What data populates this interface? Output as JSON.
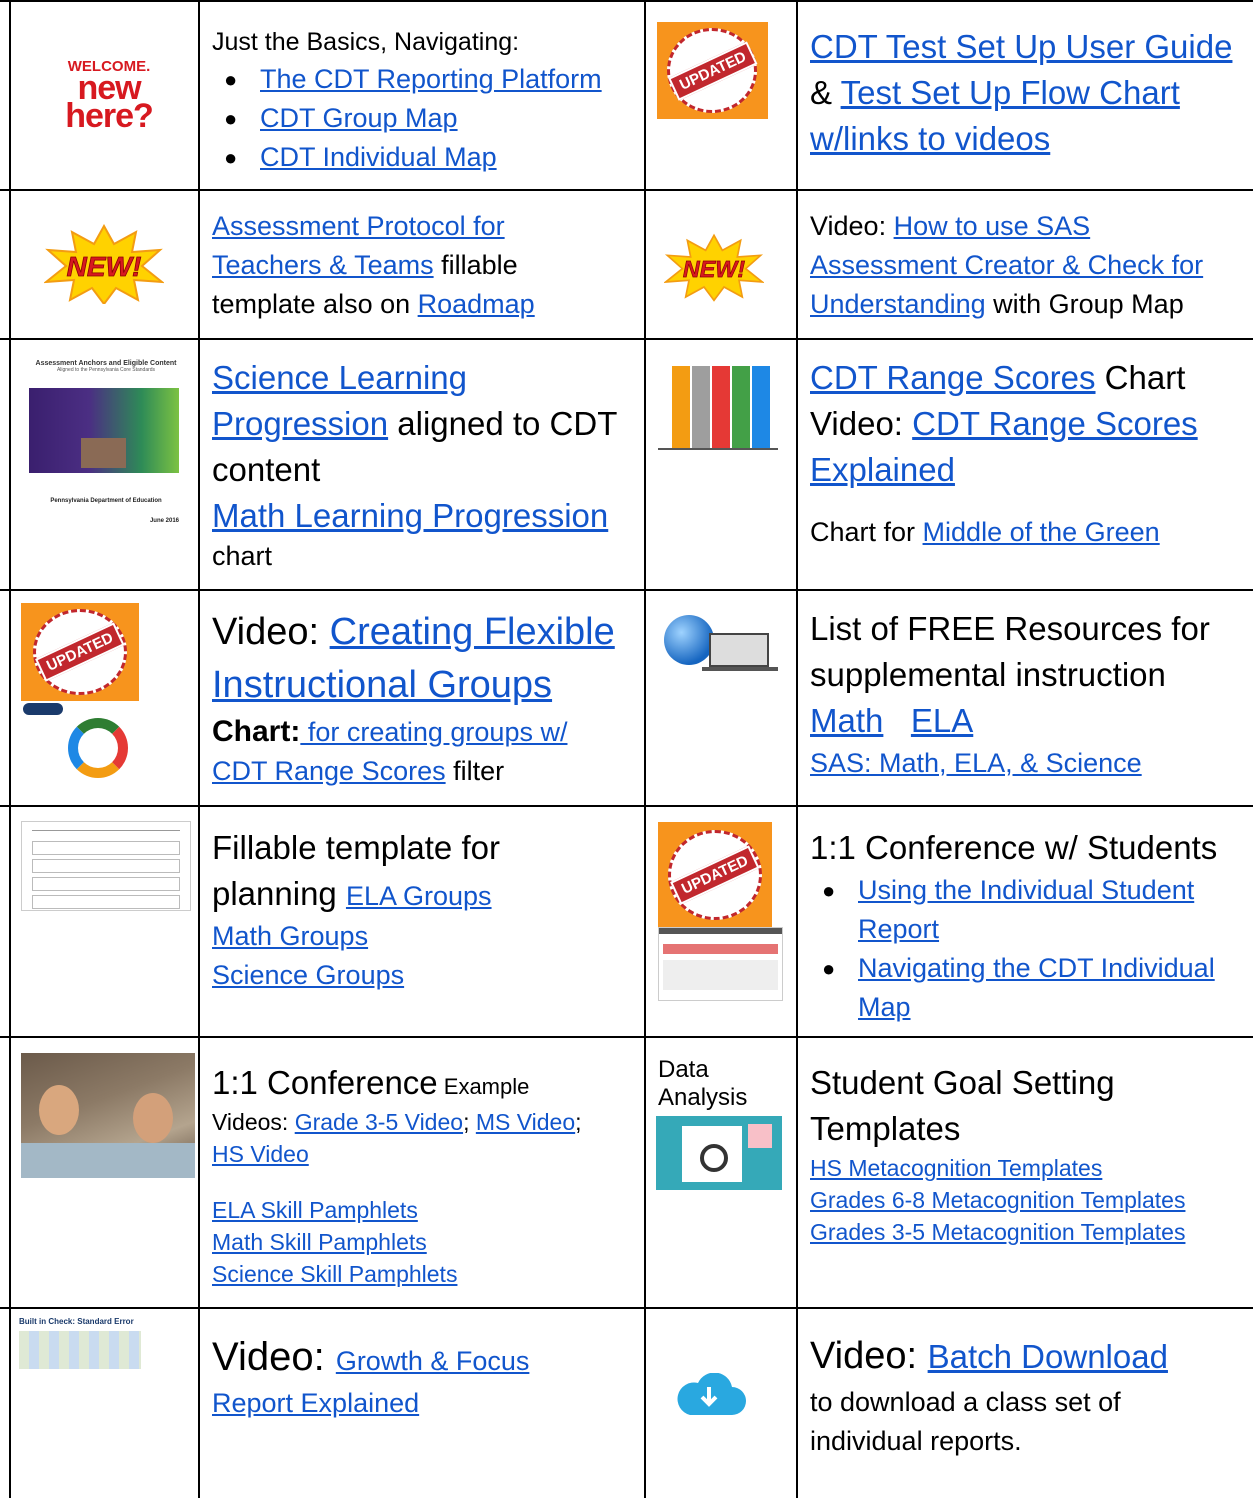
{
  "rows": {
    "r1": {
      "welcome_image": {
        "line1": "WELCOME.",
        "line2": "new",
        "line3": "here?"
      },
      "basics_heading": "Just the Basics, Navigating:",
      "basics_links": [
        "The CDT Reporting Platform",
        "CDT Group Map",
        "CDT Individual Map"
      ],
      "updated_stamp": "UPDATED",
      "guide_link": "CDT Test Set Up User Guide",
      "amp": "&",
      "flow_link_1": "Test Set Up Flow Chart",
      "flow_link_2": "w/links to videos"
    },
    "r2": {
      "new_badge": "NEW!",
      "protocol_link_1": "Assessment Protocol for",
      "protocol_link_2": "Teachers & Teams",
      "protocol_text_1": " fillable",
      "protocol_text_2": "template also on ",
      "roadmap_link": "Roadmap",
      "video_label": "Video: ",
      "sas_link_1": "How to use SAS",
      "sas_link_2": "Assessment Creator & Check for",
      "sas_link_3": "Understanding",
      "sas_text": " with Group Map"
    },
    "r3": {
      "doc_title": "Assessment Anchors and Eligible Content",
      "doc_subtitle": "Aligned to the Pennsylvania Core Standards",
      "doc_footer": "Pennsylvania Department of Education",
      "doc_date": "June 2016",
      "science_link_1": "Science Learning",
      "science_link_2": "Progression",
      "science_text": " aligned to CDT",
      "science_text_2": "content",
      "math_link": "Math Learning Progression",
      "math_text": "chart",
      "range_link": "CDT Range Scores",
      "range_text": " Chart",
      "video_label": "Video: ",
      "explained_link_1": "CDT Range Scores",
      "explained_link_2": "Explained",
      "green_text": "Chart for ",
      "green_link": "Middle of the Green"
    },
    "r4": {
      "updated_stamp": "UPDATED",
      "video_label": "Video: ",
      "flex_link_1": "Creating Flexible",
      "flex_link_2": "Instructional Groups",
      "chart_bold": "Chart:",
      "chart_link_1": " for creating groups w/",
      "chart_link_2": "CDT Range Scores",
      "chart_text": " filter",
      "free_text_1": "List of FREE Resources for",
      "free_text_2": "supplemental instruction",
      "math_link": "Math",
      "ela_link": "ELA",
      "sas_link": "SAS: Math, ELA, & Science"
    },
    "r5": {
      "fill_text_1": "Fillable template for",
      "fill_text_2": "planning ",
      "ela_groups": "ELA Groups",
      "math_groups": "Math Groups",
      "science_groups": "Science Groups",
      "updated_stamp": "UPDATED",
      "conf_title": "1:1 Conference w/ Students",
      "conf_link_1a": "Using the Individual Student",
      "conf_link_1b": "Report",
      "conf_link_2a": "Navigating the CDT Individual",
      "conf_link_2b": "Map"
    },
    "r6": {
      "conf_title": "1:1 Conference",
      "example_text": " Example",
      "videos_label": "Videos: ",
      "grade_link": "Grade 3-5 Video",
      "semi": "; ",
      "ms_link": "MS Video",
      "semi2": ";",
      "hs_link": "HS Video",
      "ela_pamph": "ELA Skill Pamphlets",
      "math_pamph": "Math Skill Pamphlets",
      "science_pamph": "Science Skill Pamphlets",
      "data_label_1": "Data",
      "data_label_2": "Analysis",
      "goal_title_1": "Student Goal Setting",
      "goal_title_2": "Templates",
      "hs_templates": "HS Metacognition Templates",
      "g68_templates": "Grades 6-8 Metacognition Templates",
      "g35_templates": "Grades 3-5 Metacognition Templates"
    },
    "r7": {
      "thumb_title": "Built in Check: Standard Error",
      "video_label": "Video: ",
      "growth_link_1": "Growth & Focus",
      "growth_link_2": "Report Explained",
      "video_label_2": "Video: ",
      "batch_link": "Batch Download",
      "batch_text_1": "to download a class set of",
      "batch_text_2": "individual reports."
    }
  },
  "colors": {
    "link": "#1155cc",
    "updated_frame": "#f7941d",
    "stamp_red": "#c1272d",
    "cloud": "#29a8e0"
  }
}
